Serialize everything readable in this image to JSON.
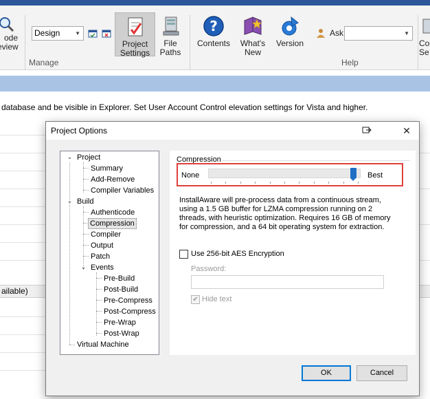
{
  "ribbon": {
    "partial_left_label": [
      "ode",
      "eview"
    ],
    "design_combo": "Design",
    "manage_group": "Manage",
    "help_group": "Help",
    "project_settings": [
      "Project",
      "Settings"
    ],
    "file_paths": [
      "File",
      "Paths"
    ],
    "contents": "Contents",
    "whats_new": [
      "What's",
      "New"
    ],
    "version": "Version",
    "ask_label": "Ask",
    "ask_value": "",
    "partial_right_label": [
      "Co",
      "Se"
    ]
  },
  "background": {
    "description": "database and be visible in Explorer. Set User Account Control elevation settings for Vista and higher.",
    "available_row": "ailable)"
  },
  "dialog": {
    "title": "Project Options",
    "tree": [
      {
        "label": "Project",
        "expanded": true
      },
      {
        "label": "Summary"
      },
      {
        "label": "Add-Remove"
      },
      {
        "label": "Compiler Variables"
      },
      {
        "label": "Build",
        "expanded": true
      },
      {
        "label": "Authenticode"
      },
      {
        "label": "Compression",
        "selected": true
      },
      {
        "label": "Compiler"
      },
      {
        "label": "Output"
      },
      {
        "label": "Patch"
      },
      {
        "label": "Events",
        "expanded": true
      },
      {
        "label": "Pre-Build"
      },
      {
        "label": "Post-Build"
      },
      {
        "label": "Pre-Compress"
      },
      {
        "label": "Post-Compress"
      },
      {
        "label": "Pre-Wrap"
      },
      {
        "label": "Post-Wrap"
      },
      {
        "label": "Virtual Machine"
      }
    ],
    "compression": {
      "group_label": "Compression",
      "min_label": "None",
      "max_label": "Best",
      "level_fraction": 0.97,
      "description": "InstallAware will pre-process data from a continuous stream, using a 1.5 GB buffer for LZMA compression running on 2 threads, with heuristic optimization. Requires 16 GB of memory for compression, and a 64 bit operating system for extraction."
    },
    "aes_label": "Use 256-bit AES Encryption",
    "aes_checked": false,
    "password_label": "Password:",
    "password_value": "",
    "hide_text_label": "Hide text",
    "hide_text_checked": true,
    "ok_label": "OK",
    "cancel_label": "Cancel"
  },
  "colors": {
    "accent_blue": "#2b579a",
    "highlight_red": "#e0403a",
    "slider_blue": "#1f6fc5"
  }
}
